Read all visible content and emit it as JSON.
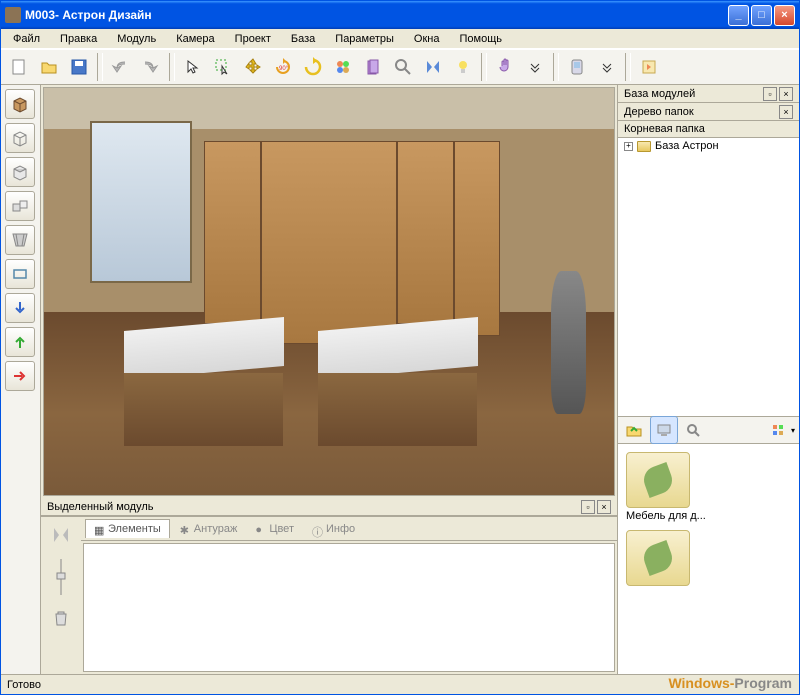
{
  "window": {
    "title": "М003- Астрон Дизайн"
  },
  "menu": [
    "Файл",
    "Правка",
    "Модуль",
    "Камера",
    "Проект",
    "База",
    "Параметры",
    "Окна",
    "Помощь"
  ],
  "toolbar_icons": [
    "new-file",
    "open-folder",
    "save",
    "undo",
    "redo",
    "pointer",
    "select-area",
    "move",
    "rotate-90",
    "rotate-free",
    "palette",
    "door",
    "zoom",
    "mirror",
    "light",
    "hand",
    "more",
    "device",
    "more2",
    "export"
  ],
  "left_tools": [
    "cube-solid",
    "cube-wire",
    "cube-top",
    "multi-cube",
    "perspective",
    "rect",
    "arrow-down",
    "arrow-up",
    "arrow-right"
  ],
  "selected_module": {
    "title": "Выделенный модуль"
  },
  "module_tabs": [
    "Элементы",
    "Антураж",
    "Цвет",
    "Инфо"
  ],
  "right_panels": {
    "modules": {
      "title": "База модулей"
    },
    "tree": {
      "title": "Дерево папок",
      "root": "Корневая папка",
      "items": [
        "База Астрон"
      ]
    }
  },
  "browser_items": [
    "Мебель для д...",
    ""
  ],
  "status": "Готово",
  "watermark": {
    "p1": "Windows-",
    "p2": "Program"
  }
}
